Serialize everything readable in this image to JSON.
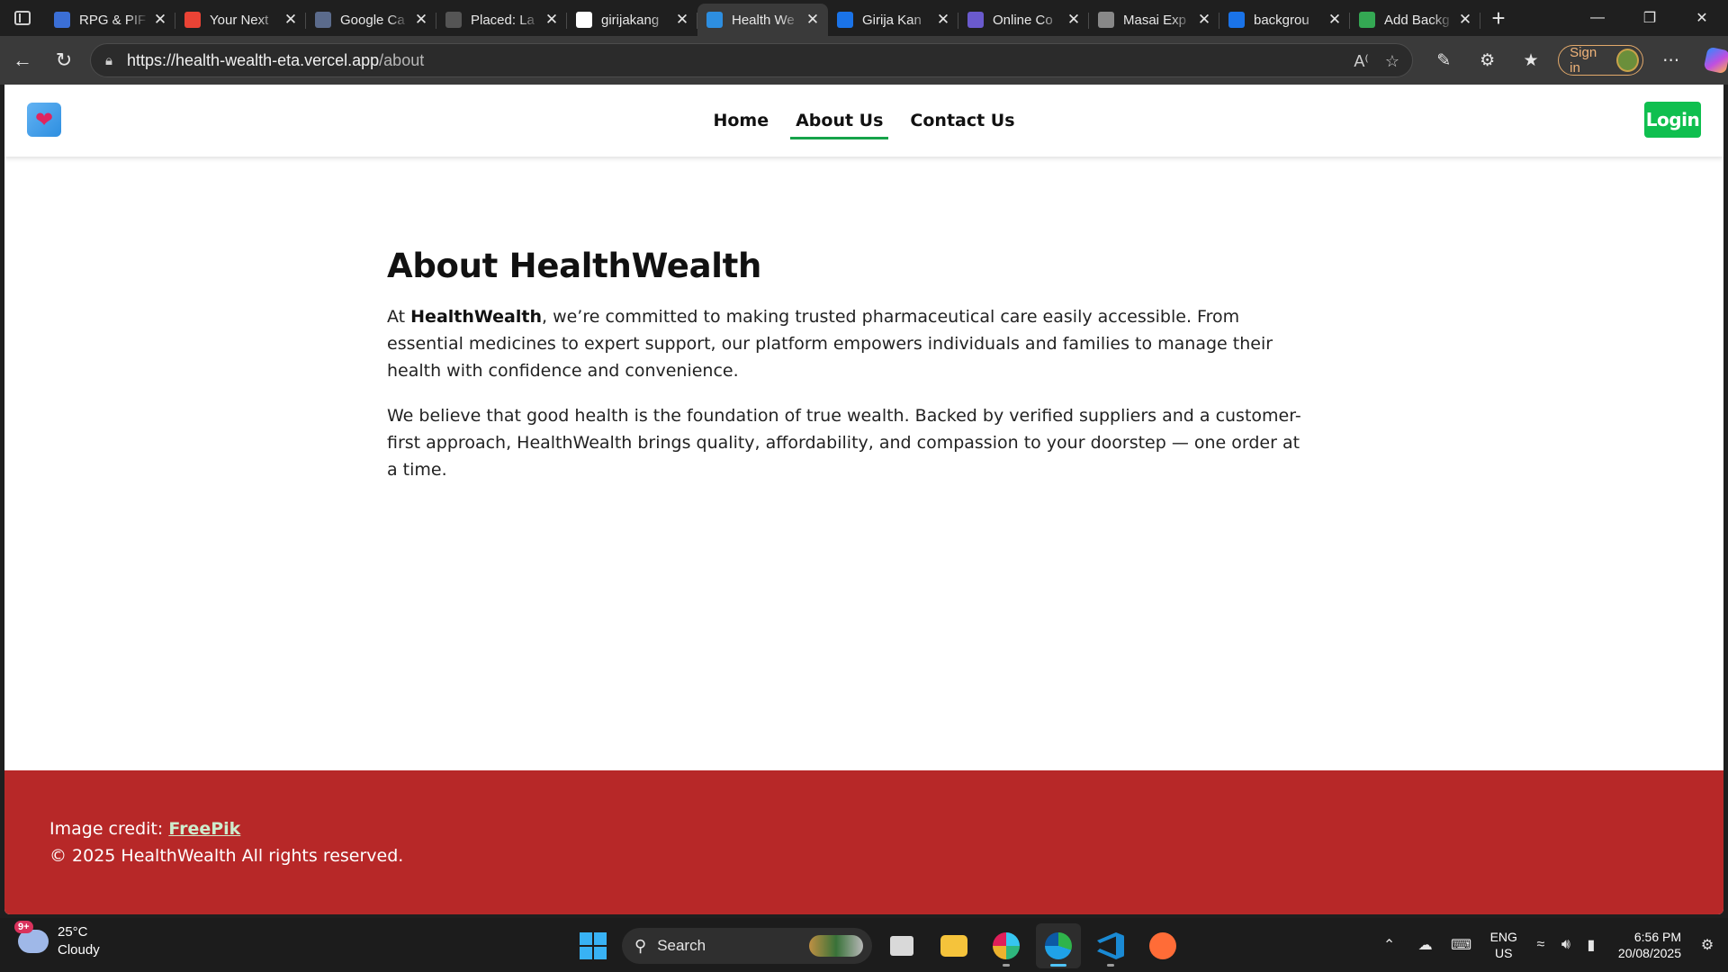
{
  "browser": {
    "tabs": [
      {
        "title": "RPG & PIF",
        "favicon_color": "#3b6fd6",
        "active": false
      },
      {
        "title": "Your Next",
        "favicon_color": "#ea4335",
        "active": false
      },
      {
        "title": "Google Ca",
        "favicon_color": "#5b6b8c",
        "active": false
      },
      {
        "title": "Placed: La",
        "favicon_color": "#555555",
        "active": false
      },
      {
        "title": "girijakang",
        "favicon_color": "#ffffff",
        "active": false
      },
      {
        "title": "Health We",
        "favicon_color": "#2d8ee0",
        "active": true
      },
      {
        "title": "Girija Kan",
        "favicon_color": "#1a73e8",
        "active": false
      },
      {
        "title": "Online Co",
        "favicon_color": "#6a5acd",
        "active": false
      },
      {
        "title": "Masai Exp",
        "favicon_color": "#888888",
        "active": false
      },
      {
        "title": "backgrou",
        "favicon_color": "#1a73e8",
        "active": false
      },
      {
        "title": "Add Backg",
        "favicon_color": "#34a853",
        "active": false
      }
    ],
    "url_host": "https://health-wealth-eta.vercel.app",
    "url_path": "/about",
    "signin_label": "Sign in"
  },
  "site": {
    "nav": [
      {
        "label": "Home",
        "active": false
      },
      {
        "label": "About Us",
        "active": true
      },
      {
        "label": "Contact Us",
        "active": false
      }
    ],
    "login_label": "Login",
    "about": {
      "heading": "About HealthWealth",
      "p1_prefix": "At ",
      "p1_brand": "HealthWealth",
      "p1_rest": ", we’re committed to making trusted pharmaceutical care easily accessible. From essential medicines to expert support, our platform empowers individuals and families to manage their health with confidence and convenience.",
      "p2": "We believe that good health is the foundation of true wealth. Backed by verified suppliers and a customer-first approach, HealthWealth brings quality, affordability, and compassion to your doorstep — one order at a time."
    },
    "footer": {
      "credit_prefix": "Image credit: ",
      "credit_link": "FreePik",
      "copyright": "© 2025 HealthWealth All rights reserved."
    },
    "colors": {
      "footer_bg": "#b72828",
      "login_bg": "#0fbf4f",
      "nav_underline": "#16a34a"
    }
  },
  "taskbar": {
    "weather_badge": "9+",
    "temperature": "25°C",
    "condition": "Cloudy",
    "search_label": "Search",
    "lang_top": "ENG",
    "lang_bottom": "US",
    "time": "6:56 PM",
    "date": "20/08/2025"
  }
}
